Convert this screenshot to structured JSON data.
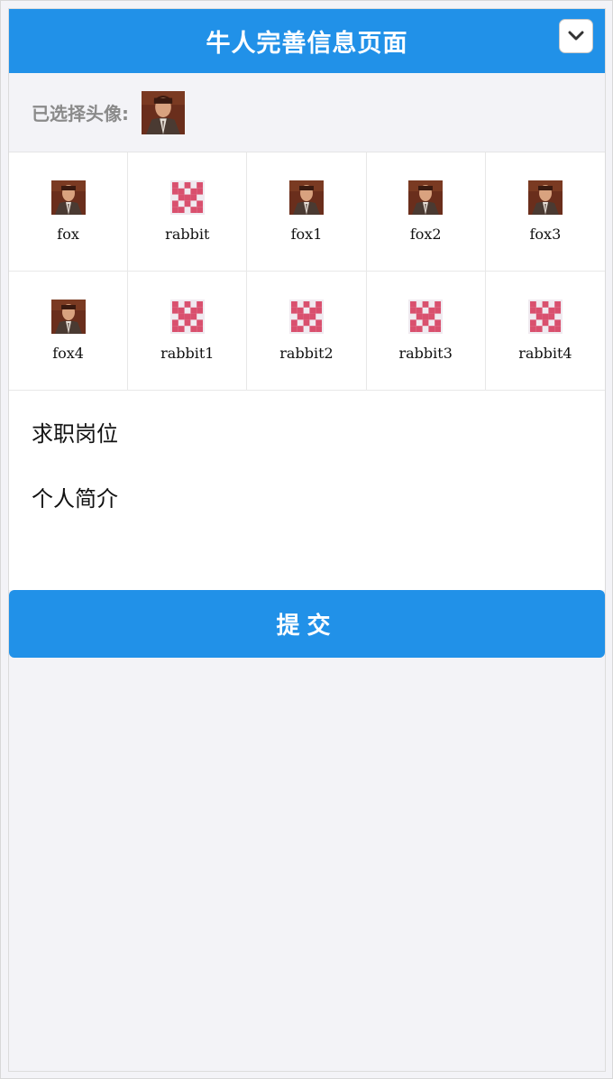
{
  "header": {
    "title": "牛人完善信息页面",
    "menu_icon": "chevron-down-icon",
    "color": "#2191e8"
  },
  "selected": {
    "label": "已选择头像:",
    "avatar": "fox"
  },
  "avatars": [
    {
      "label": "fox",
      "type": "photo"
    },
    {
      "label": "rabbit",
      "type": "pattern"
    },
    {
      "label": "fox1",
      "type": "photo"
    },
    {
      "label": "fox2",
      "type": "photo"
    },
    {
      "label": "fox3",
      "type": "photo"
    },
    {
      "label": "fox4",
      "type": "photo"
    },
    {
      "label": "rabbit1",
      "type": "pattern"
    },
    {
      "label": "rabbit2",
      "type": "pattern"
    },
    {
      "label": "rabbit3",
      "type": "pattern"
    },
    {
      "label": "rabbit4",
      "type": "pattern"
    }
  ],
  "form": {
    "job_label": "求职岗位",
    "intro_label": "个人简介"
  },
  "submit": {
    "label": "提交"
  }
}
